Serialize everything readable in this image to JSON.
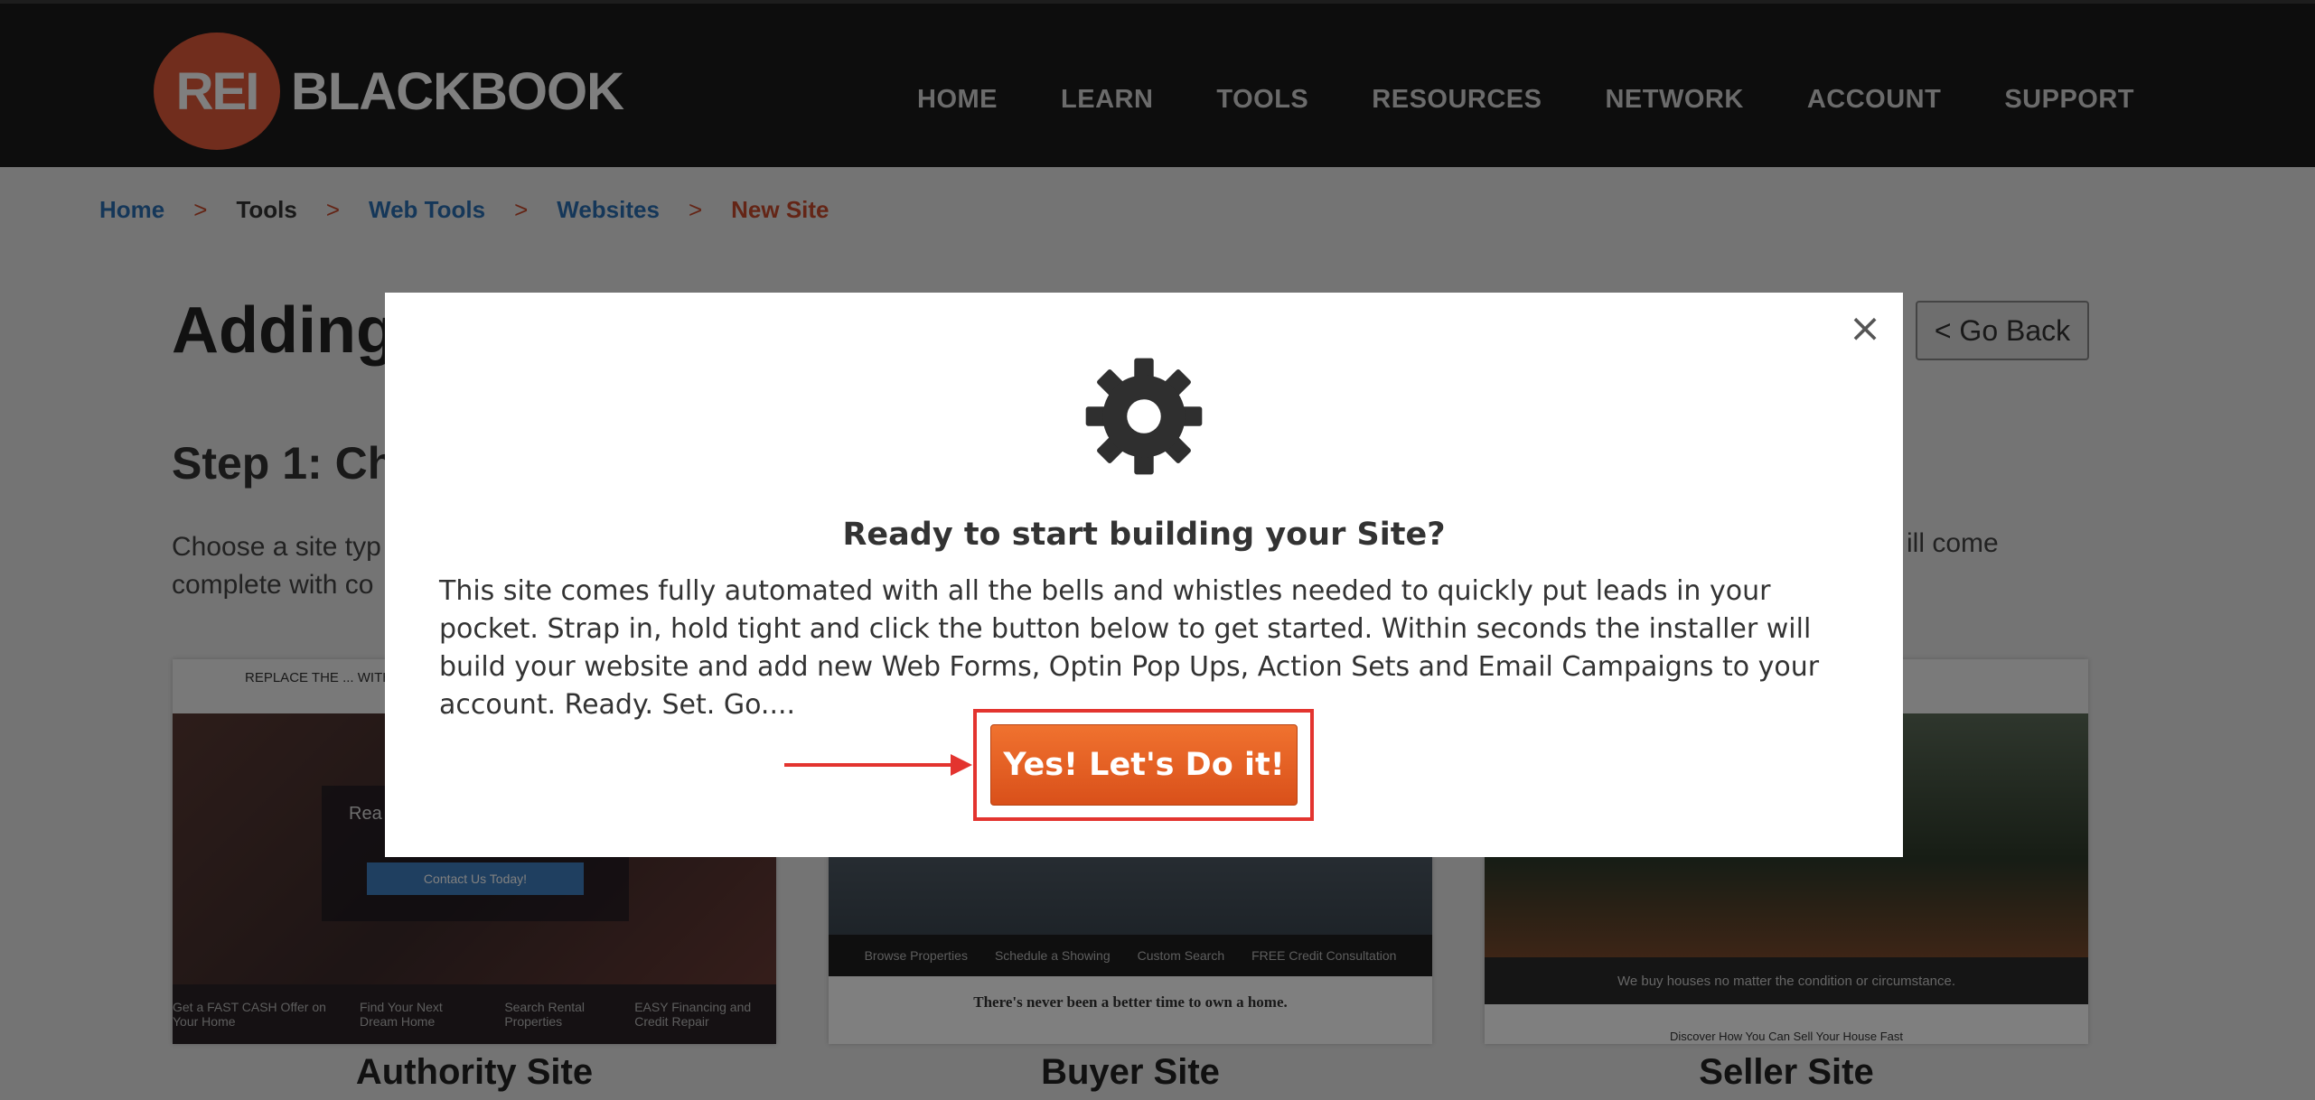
{
  "header": {
    "logo_mark": "REI",
    "logo_word": "BLACKBOOK",
    "nav": [
      "HOME",
      "LEARN",
      "TOOLS",
      "RESOURCES",
      "NETWORK",
      "ACCOUNT",
      "SUPPORT"
    ]
  },
  "breadcrumb": {
    "items": [
      "Home",
      "Tools",
      "Web Tools",
      "Websites",
      "New Site"
    ],
    "separator": ">"
  },
  "page": {
    "title_visible": "Adding",
    "go_back_label": "< Go Back",
    "step_heading_visible": "Step 1: Ch",
    "desc_left_line1": "Choose a site typ",
    "desc_left_line2": "complete with co",
    "desc_right": "ill come"
  },
  "cards": [
    {
      "caption": "Authority Site",
      "header_text": "REPLACE THE ... WITH YOUR OWN",
      "button_text": "Contact Us Today!",
      "hero_fragment": "Rea",
      "strip_items": [
        "Get a FAST CASH Offer on Your Home",
        "Find Your Next Dream Home",
        "Search Rental Properties",
        "EASY Financing and Credit Repair"
      ]
    },
    {
      "caption": "Buyer Site",
      "strip_items": [
        "Browse Properties",
        "Schedule a Showing",
        "Custom Search",
        "FREE Credit Consultation"
      ],
      "tagline": "There's never been a better time to own a home."
    },
    {
      "caption": "Seller Site",
      "strip_text": "We buy houses no matter the condition or circumstance.",
      "footer_text": "Discover How You Can Sell Your House Fast"
    }
  ],
  "modal": {
    "close_symbol": "×",
    "icon": "gear-icon",
    "title": "Ready to start building your Site?",
    "body": "This site comes fully automated with all the bells and whistles needed to quickly put leads in your pocket. Strap in, hold tight and click the button below to get started. Within seconds the installer will build your website and add new Web Forms, Optin Pop Ups, Action Sets and Email Campaigns to your account. Ready. Set. Go....",
    "cta_label": "Yes! Let's Do it!"
  },
  "colors": {
    "header_bg": "#1b1b1b",
    "brand_orange": "#e35a3b",
    "link_blue": "#2a6fb2",
    "crumb_current": "#c84a2c",
    "cta_orange": "#e8612a",
    "annotation_red": "#e3342f"
  }
}
